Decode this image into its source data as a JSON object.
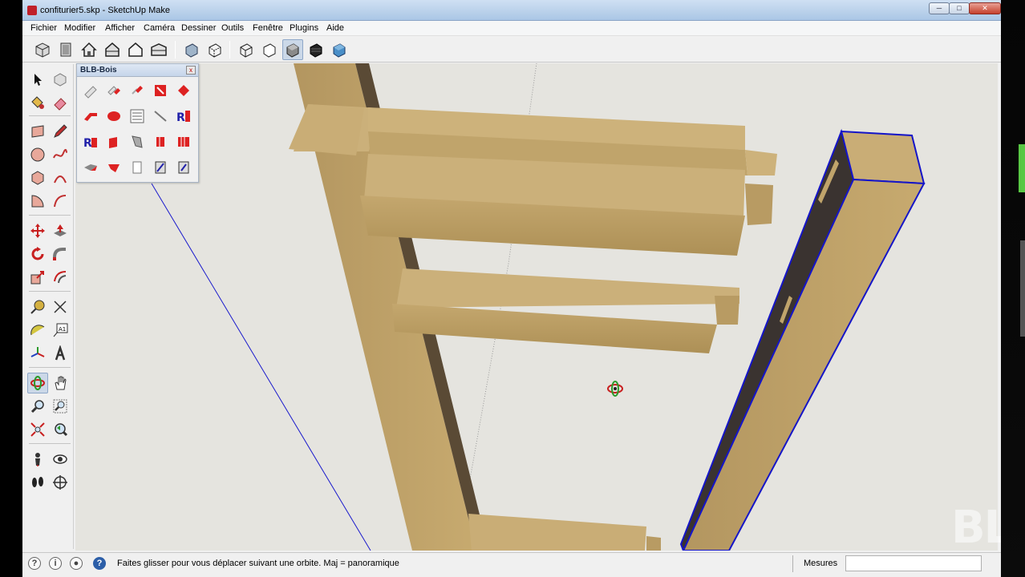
{
  "window": {
    "title": "confiturier5.skp - SketchUp Make",
    "buttons": {
      "minimize": "─",
      "maximize": "□",
      "close": "✕"
    }
  },
  "menu": [
    "Fichier",
    "Modifier",
    "Afficher",
    "Caméra",
    "Dessiner",
    "Outils",
    "Fenêtre",
    "Plugins",
    "Aide"
  ],
  "toolbar": {
    "views": [
      "iso-view-icon",
      "top-view-icon",
      "front-view-icon",
      "right-view-icon",
      "back-view-icon",
      "left-view-icon"
    ],
    "styles": [
      "xray-icon",
      "back-edges-icon",
      "wireframe-icon",
      "hidden-line-icon",
      "shaded-icon",
      "shaded-textures-icon",
      "monochrome-icon"
    ],
    "active": "shaded-icon"
  },
  "blb_panel": {
    "title": "BLB-Bois",
    "close": "x",
    "icons": [
      "rod-icon",
      "cut-rod-icon",
      "drill-icon",
      "mortise-icon",
      "tenon-icon",
      "miter-icon",
      "round-piece-icon",
      "list-icon",
      "line-icon",
      "rename-icon",
      "profile-r-icon",
      "block-icon",
      "board-icon",
      "joint-icon",
      "clamp-icon",
      "notch-icon",
      "chamfer-icon",
      "panel-icon",
      "slot-icon",
      "groove-icon"
    ]
  },
  "left_tools": [
    "select-icon",
    "component-icon",
    "paint-bucket-icon",
    "eraser-icon",
    "rectangle-icon",
    "pencil-icon",
    "circle-icon",
    "freehand-icon",
    "polygon-icon",
    "arc-icon",
    "pie-icon",
    "arc-2pt-icon",
    "move-icon",
    "push-pull-icon",
    "rotate-icon",
    "follow-me-icon",
    "scale-icon",
    "offset-icon",
    "tape-measure-icon",
    "dimension-icon",
    "protractor-icon",
    "text-icon",
    "axes-icon",
    "3d-text-icon",
    "orbit-icon",
    "pan-icon",
    "zoom-icon",
    "zoom-window-icon",
    "zoom-extents-icon",
    "previous-view-icon",
    "position-camera-icon",
    "look-around-icon",
    "walk-icon",
    "section-plane-icon"
  ],
  "status": {
    "message": "Faites glisser pour vous déplacer suivant une orbite.  Maj = panoramique",
    "help": "?",
    "measure_label": "Mesures",
    "measure_value": ""
  },
  "watermark": "BLB",
  "colors": {
    "wood": "#c4a76e",
    "wood_dark": "#a58a53",
    "wood_shadow": "#5a4a35",
    "selection": "#1515c8",
    "viewport": "#e5e4df"
  }
}
